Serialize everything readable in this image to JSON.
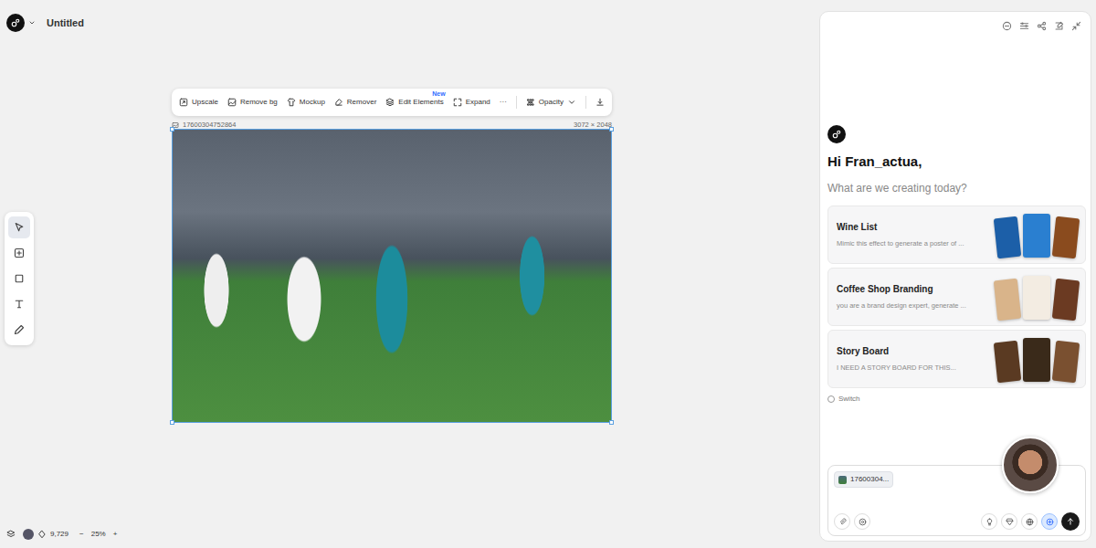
{
  "app": {
    "title": "Untitled"
  },
  "toolbar": {
    "items": [
      {
        "label": "Upscale"
      },
      {
        "label": "Remove bg"
      },
      {
        "label": "Mockup"
      },
      {
        "label": "Remover"
      },
      {
        "label": "Edit Elements",
        "badge": "New"
      },
      {
        "label": "Expand"
      }
    ],
    "more": "···",
    "opacity": "Opacity"
  },
  "image": {
    "name": "17600304752864",
    "size": "3072 × 2048"
  },
  "tools": [
    {
      "selected": true
    },
    {
      "selected": false
    },
    {
      "selected": false
    },
    {
      "selected": false
    },
    {
      "selected": false
    }
  ],
  "footer": {
    "credits": "9,729",
    "zoom_out": "−",
    "zoom": "25%",
    "zoom_in": "+"
  },
  "assistant": {
    "greeting": "Hi Fran_actua,",
    "prompt": "What are we creating today?",
    "cards": [
      {
        "title": "Wine List",
        "description": "Mimic this effect to generate a poster of ..."
      },
      {
        "title": "Coffee Shop Branding",
        "description": "you are a brand design expert, generate ..."
      },
      {
        "title": "Story Board",
        "description": "I NEED A STORY BOARD FOR THIS..."
      }
    ],
    "switch": "Switch",
    "attachment": "17600304...",
    "options": [
      {
        "selected": false
      },
      {
        "selected": false
      },
      {
        "selected": false
      },
      {
        "selected": true
      }
    ]
  }
}
